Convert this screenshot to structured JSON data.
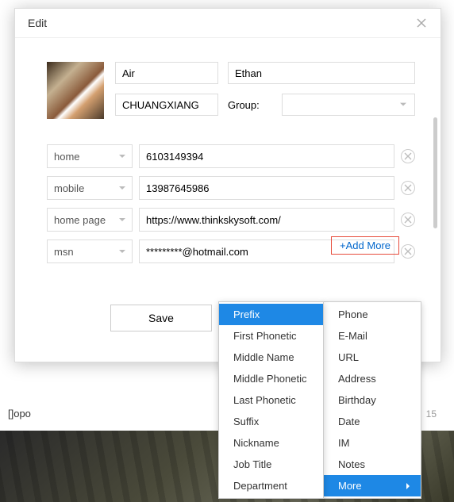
{
  "modal": {
    "title": "Edit",
    "firstName": "Air",
    "lastName": "Ethan",
    "company": "CHUANGXIANG",
    "groupLabel": "Group:",
    "groupValue": "",
    "saveLabel": "Save",
    "addMoreLabel": "+Add More"
  },
  "fields": [
    {
      "type": "home",
      "value": "6103149394"
    },
    {
      "type": "mobile",
      "value": "13987645986"
    },
    {
      "type": "home page",
      "value": "https://www.thinkskysoft.com/"
    },
    {
      "type": "msn",
      "value": "*********@hotmail.com"
    }
  ],
  "menu1": [
    "Phone",
    "E-Mail",
    "URL",
    "Address",
    "Birthday",
    "Date",
    "IM",
    "Notes",
    "More"
  ],
  "menu1Selected": "More",
  "menu2": [
    "Prefix",
    "First Phonetic",
    "Middle Name",
    "Middle Phonetic",
    "Last Phonetic",
    "Suffix",
    "Nickname",
    "Job Title",
    "Department"
  ],
  "menu2Selected": "Prefix",
  "bgList": {
    "name": "[]opo",
    "count": "15"
  }
}
